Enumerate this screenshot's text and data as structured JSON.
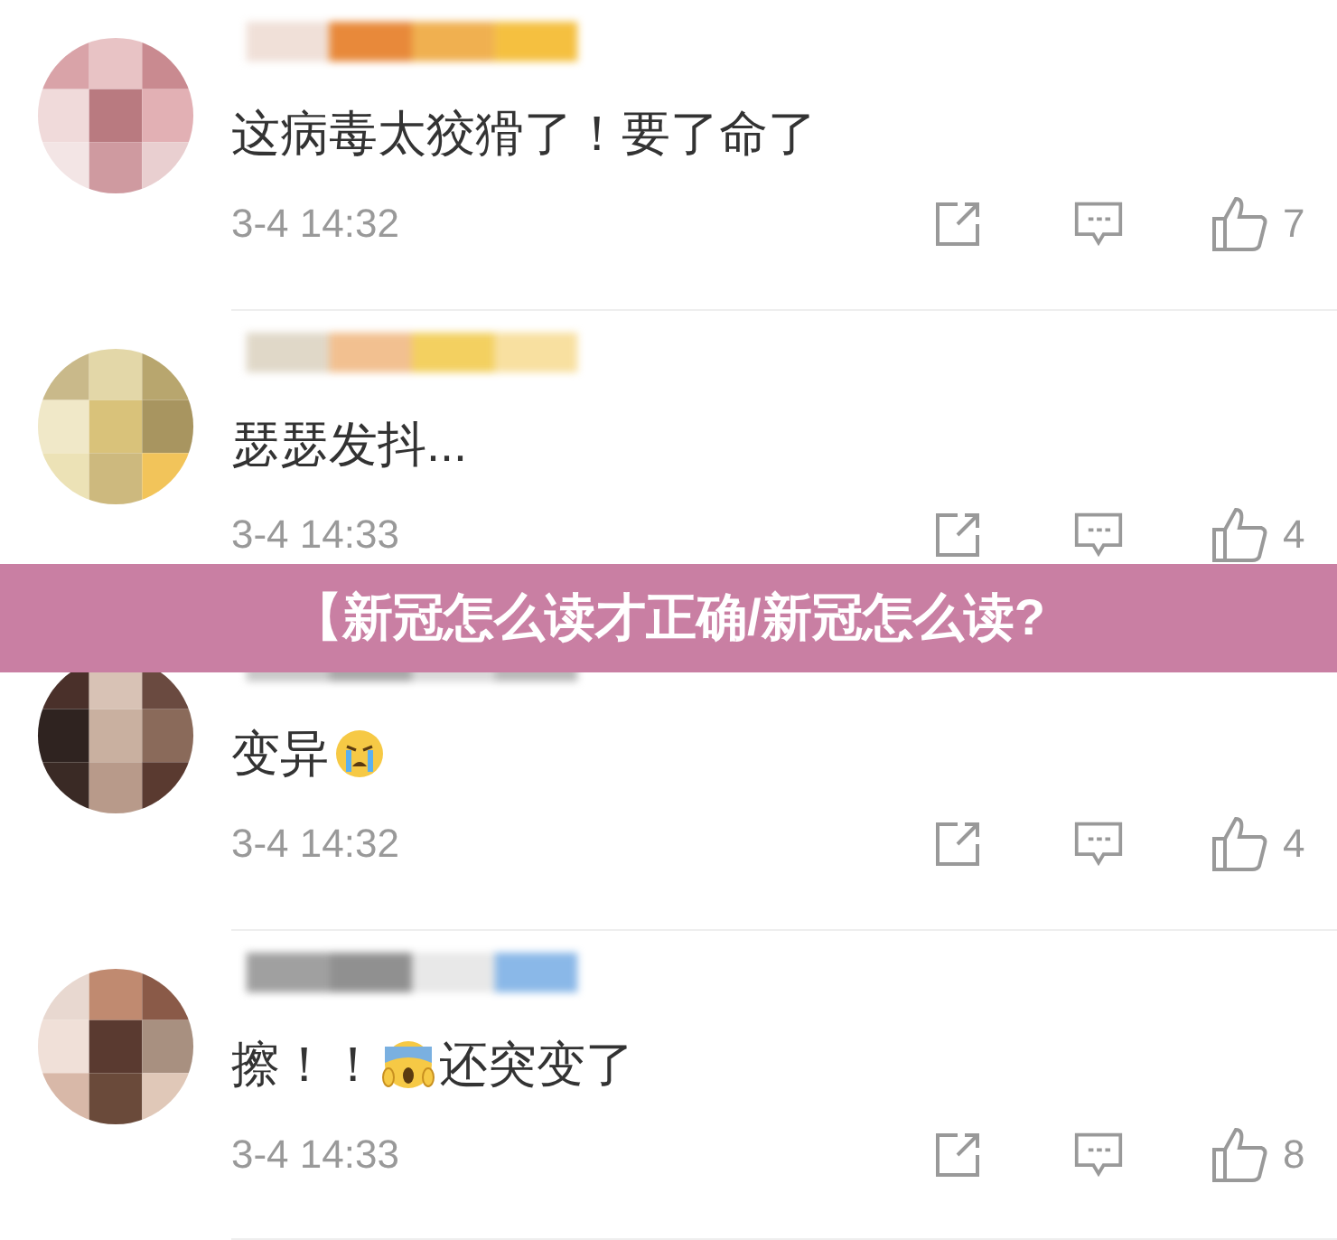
{
  "comments": [
    {
      "segments": [
        {
          "kind": "text",
          "text": "这病毒太狡猾了！要了命了"
        }
      ],
      "time": "3-4 14:32",
      "likes": "7"
    },
    {
      "segments": [
        {
          "kind": "text",
          "text": "瑟瑟发抖..."
        }
      ],
      "time": "3-4 14:33",
      "likes": "4"
    },
    {
      "segments": [
        {
          "kind": "text",
          "text": "变异"
        },
        {
          "kind": "crying"
        }
      ],
      "time": "3-4 14:32",
      "likes": "4"
    },
    {
      "segments": [
        {
          "kind": "text",
          "text": "擦！！"
        },
        {
          "kind": "scream"
        },
        {
          "kind": "text",
          "text": "还突变了"
        }
      ],
      "time": "3-4 14:33",
      "likes": "8"
    }
  ],
  "banner": {
    "title": "【新冠怎么读才正确/新冠怎么读?"
  }
}
